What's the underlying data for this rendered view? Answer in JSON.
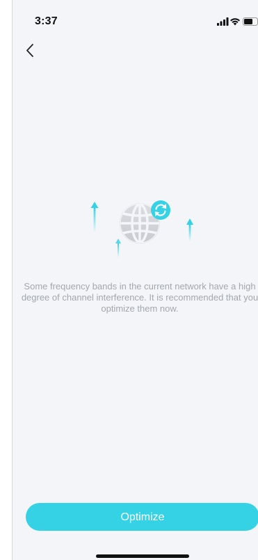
{
  "status_bar": {
    "time": "3:37",
    "icons": [
      "signal-icon",
      "wifi-icon",
      "battery-icon"
    ]
  },
  "nav": {
    "back_icon": "chevron-left-icon"
  },
  "illustration": {
    "icons": [
      "globe-icon",
      "refresh-icon",
      "arrow-up-icon"
    ]
  },
  "content": {
    "message": "Some frequency bands in the current network have a high degree of channel interference. It is recommended that you optimize them now."
  },
  "actions": {
    "optimize_label": "Optimize"
  },
  "colors": {
    "accent": "#35d2e6",
    "background": "#f4f5f9",
    "message_text": "#a3a6ad"
  }
}
